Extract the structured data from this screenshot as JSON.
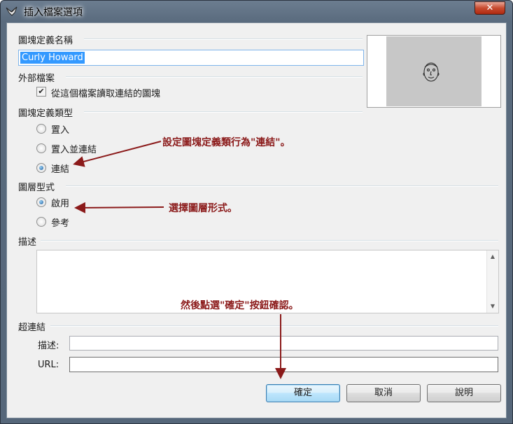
{
  "window": {
    "title": "插入檔案選項",
    "close_label": "✕"
  },
  "block_name": {
    "label": "圖塊定義名稱",
    "value": "Curly Howard"
  },
  "external_file": {
    "label": "外部檔案",
    "checkbox_label": "從這個檔案讀取連結的圖塊",
    "checked": true
  },
  "block_type": {
    "label": "圖塊定義類型",
    "options": [
      {
        "label": "置入",
        "selected": false
      },
      {
        "label": "置入並連結",
        "selected": false
      },
      {
        "label": "連結",
        "selected": true
      }
    ]
  },
  "layer_style": {
    "label": "圖層型式",
    "options": [
      {
        "label": "啟用",
        "selected": true
      },
      {
        "label": "參考",
        "selected": false
      }
    ]
  },
  "description": {
    "label": "描述",
    "value": ""
  },
  "hyperlink": {
    "label": "超連結",
    "description_label": "描述:",
    "description_value": "",
    "url_label": "URL:",
    "url_value": ""
  },
  "buttons": {
    "ok": "確定",
    "cancel": "取消",
    "help": "說明"
  },
  "annotations": {
    "block_type_note": "設定圖塊定義類行為\"連結\"。",
    "layer_style_note": "選擇圖層形式。",
    "ok_note": "然後點選\"確定\"按鈕確認。"
  },
  "colors": {
    "annotation": "#8b1a1a",
    "selection": "#3399ff"
  },
  "icons": {
    "app": "rhino-icon",
    "close": "close-icon",
    "check": "check-icon",
    "scroll_up": "scroll-up-arrow-icon",
    "scroll_down": "scroll-down-arrow-icon"
  }
}
